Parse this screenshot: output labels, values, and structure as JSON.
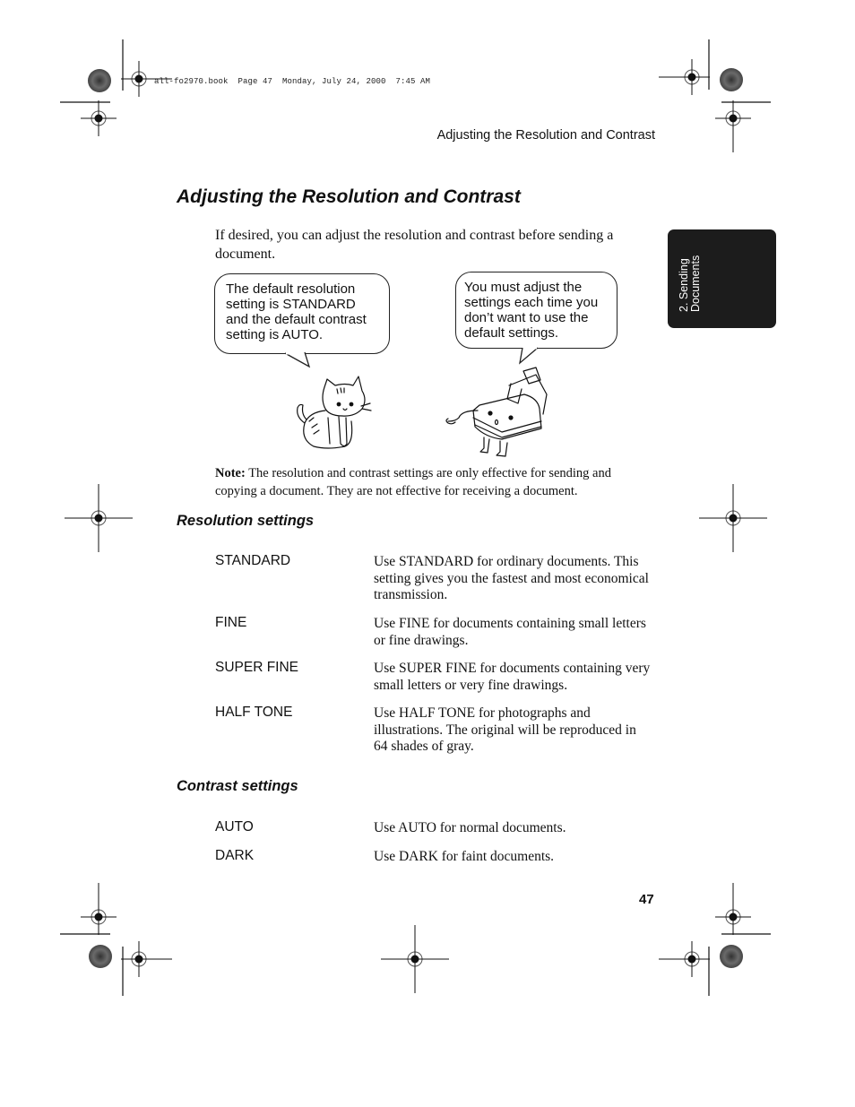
{
  "print_info": "all-fo2970.book  Page 47  Monday, July 24, 2000  7:45 AM",
  "running_header": "Adjusting the Resolution and Contrast",
  "page_title": "Adjusting the Resolution and Contrast",
  "intro": "If desired, you can adjust the resolution and contrast before sending a document.",
  "side_tab": {
    "line1": "2. Sending",
    "line2": "Documents"
  },
  "illustration": {
    "bubble_left": "The default resolution setting is STANDARD and the default contrast setting is AUTO.",
    "bubble_right": "You must adjust the settings each time you don’t want to use the default settings.",
    "characters": [
      "cat",
      "fax-machine"
    ]
  },
  "note": {
    "label": "Note:",
    "text": " The resolution and contrast settings are only effective for sending and copying a document. They are not effective for receiving a document."
  },
  "resolution_settings": {
    "title": "Resolution settings",
    "items": [
      {
        "term": "STANDARD",
        "description": "Use STANDARD for ordinary documents. This setting gives you the fastest and most economical transmission."
      },
      {
        "term": "FINE",
        "description": "Use FINE for documents containing small letters or fine drawings."
      },
      {
        "term": "SUPER FINE",
        "description": "Use SUPER FINE for documents containing very small letters or very fine drawings."
      },
      {
        "term": "HALF TONE",
        "description": "Use HALF TONE for photographs and illustrations. The original will be reproduced in 64 shades of gray."
      }
    ]
  },
  "contrast_settings": {
    "title": "Contrast settings",
    "items": [
      {
        "term": "AUTO",
        "description": "Use AUTO for normal documents."
      },
      {
        "term": "DARK",
        "description": "Use DARK for faint documents."
      }
    ]
  },
  "page_number": "47"
}
